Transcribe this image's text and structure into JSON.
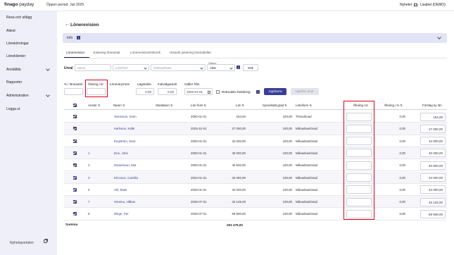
{
  "topbar": {
    "logo_main": "finago",
    "logo_sub": " payday",
    "period": "Öppen period: Juli 2025",
    "news": "Nyheter",
    "user": "Lisabet (DEMO)"
  },
  "sidebar": {
    "items": [
      {
        "label": "Resa och utlägg",
        "expandable": false
      },
      {
        "label": "Attest",
        "expandable": false
      },
      {
        "label": "Lönekörningar",
        "expandable": false
      },
      {
        "label": "Löneklienter",
        "expandable": false
      },
      {
        "label": "Anställda",
        "expandable": true
      },
      {
        "label": "Rapporter",
        "expandable": false
      },
      {
        "label": "Administration",
        "expandable": true
      },
      {
        "label": "Logga ut",
        "expandable": false
      }
    ],
    "news_portal": "Nyhetsportalen"
  },
  "page": {
    "back_icon": "←",
    "title": "Lönerevision",
    "info_label": "Info",
    "info_badge": "i"
  },
  "tabs": [
    {
      "label": "Lönerevision",
      "active": true
    },
    {
      "label": "Justering löneavtal",
      "active": false
    },
    {
      "label": "Lönerevisionshistorik",
      "active": false
    },
    {
      "label": "Historik justering lönetabeller",
      "active": false
    }
  ],
  "filters": {
    "label": "Urval",
    "name_placeholder": "Namn",
    "wage_form_placeholder": "Löneform",
    "activities_placeholder": "Verksamheter",
    "status_label": "Status",
    "status_value": "Aktiv",
    "info_badge": "i",
    "search_button": "Sök"
  },
  "adjust": {
    "percent_label": "% i löneavtal",
    "increase_label": "Ökning i kr",
    "wage_space_label": "Löneutrymme",
    "min_wage_label": "Lägstalön",
    "individual_label": "Individgaranti",
    "valid_from_label": "Gäller från",
    "min_wage_value": "0,00",
    "individual_value": "0,00",
    "valid_from_value": "2026-01-01",
    "retro_label": "Retroaktiv betalning",
    "retro_info": "i",
    "apply_button": "Applicera",
    "undo_button": "Upphäv ändr."
  },
  "table": {
    "headers": {
      "anstnr": "Anstnr",
      "name": "Namn",
      "end_date": "Slutdatum",
      "salary_from": "Lön from",
      "salary": "Lön",
      "employment_rate": "Sysselsätt.grad",
      "wage_form": "Löneform",
      "increase_kr": "Ökning i kr",
      "increase_pct": "Ökning i %",
      "proposed_salary": "Förslag ny lön",
      "sort_icon": "⇅"
    },
    "rows": [
      {
        "anstnr": "",
        "name": "Svensson, Sven",
        "end_date": "",
        "salary_from": "2000-01-01",
        "salary": "154,00",
        "rate": "100,00",
        "wage_form": "Timavlönad",
        "increase_kr": "",
        "increase_pct": "0,00",
        "proposed": "154,00"
      },
      {
        "anstnr": "",
        "name": "Karlsson, Kalle",
        "end_date": "",
        "salary_from": "2025-10-01",
        "salary": "27 000,00",
        "rate": "100,00",
        "wage_form": "Månadsavlönad",
        "increase_kr": "",
        "increase_pct": "0,00",
        "proposed": "27 000,00"
      },
      {
        "anstnr": "",
        "name": "Engström, Sara",
        "end_date": "",
        "salary_from": "2000-01-01",
        "salary": "34 000,00",
        "rate": "100,00",
        "wage_form": "Månadsavlönad",
        "increase_kr": "",
        "increase_pct": "0,00",
        "proposed": "34 000,00"
      },
      {
        "anstnr": "1",
        "name": "Doe, John",
        "end_date": "",
        "salary_from": "2000-01-01",
        "salary": "40 000,00",
        "rate": "100,00",
        "wage_form": "Månadsavlönad",
        "increase_kr": "",
        "increase_pct": "0,00",
        "proposed": "40 000,00"
      },
      {
        "anstnr": "2",
        "name": "Danielsson, Mia",
        "end_date": "",
        "salary_from": "2000-01-01",
        "salary": "40 500,00",
        "rate": "100,00",
        "wage_form": "Månadsavlönad",
        "increase_kr": "",
        "increase_pct": "0,00",
        "proposed": "40 500,00"
      },
      {
        "anstnr": "3",
        "name": "Ericsson, Camilla",
        "end_date": "",
        "salary_from": "2024-01-01",
        "salary": "34 000,00",
        "rate": "100,00",
        "wage_form": "Månadsavlönad",
        "increase_kr": "",
        "increase_pct": "0,00",
        "proposed": "34 000,00"
      },
      {
        "anstnr": "6",
        "name": "Ahl, Mats",
        "end_date": "",
        "salary_from": "2025-01-01",
        "salary": "34 000,00",
        "rate": "100,00",
        "wage_form": "Månadsavlönad",
        "increase_kr": "",
        "increase_pct": "0,00",
        "proposed": "34 000,00"
      },
      {
        "anstnr": "7",
        "name": "Smeteu, Håkan",
        "end_date": "",
        "salary_from": "2025-07-01",
        "salary": "33 125,00",
        "rate": "100,00",
        "wage_form": "Månadsavlönad",
        "increase_kr": "",
        "increase_pct": "0,00",
        "proposed": "33 125,00"
      },
      {
        "anstnr": "8",
        "name": "Wirge, Per",
        "end_date": "",
        "salary_from": "2025-07-01",
        "salary": "59 900,00",
        "rate": "100,00",
        "wage_form": "Månadsavlönad",
        "increase_kr": "",
        "increase_pct": "0,00",
        "proposed": "59 900,00"
      }
    ],
    "sum_label": "Summa",
    "sum_value": "293 479,00"
  },
  "colors": {
    "accent": "#3a3f96",
    "sidebar_bg": "#eeeff8",
    "highlight": "#e0001b"
  }
}
